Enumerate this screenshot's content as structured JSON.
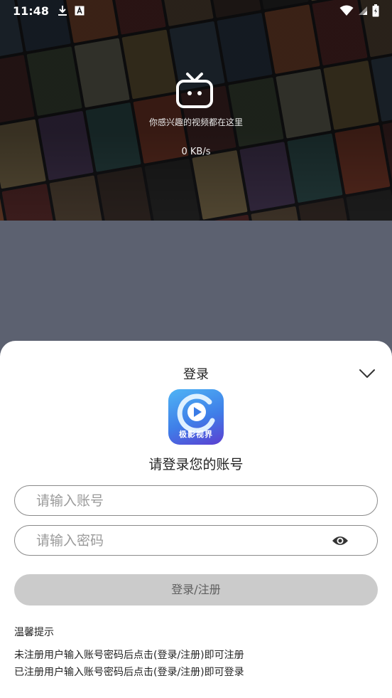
{
  "status_bar": {
    "time": "11:48",
    "icons": [
      "download-icon",
      "text-a-icon",
      "wifi-icon",
      "signal-icon",
      "battery-icon"
    ]
  },
  "hero": {
    "logo_icon": "tv-icon",
    "tagline": "你感兴趣的视频都在这里",
    "speed": "0 KB/s"
  },
  "login_sheet": {
    "title": "登录",
    "collapse_icon": "chevron-down-icon",
    "app_icon": {
      "name": "极影视界",
      "icon": "play-icon"
    },
    "subtitle": "请登录您的账号",
    "account_field": {
      "value": "",
      "placeholder": "请输入账号"
    },
    "password_field": {
      "value": "",
      "placeholder": "请输入密码",
      "toggle_icon": "eye-icon"
    },
    "submit_label": "登录/注册",
    "tips": {
      "title": "温馨提示",
      "lines": [
        "未注册用户输入账号密码后点击(登录/注册)即可注册",
        "已注册用户输入账号密码后点击(登录/注册)即可登录"
      ]
    }
  },
  "colors": {
    "sheet_background": "#ffffff",
    "dim_background": "#5c6170",
    "button_disabled": "#cbcbcb",
    "button_text": "#5e5e5e",
    "app_icon_gradient": [
      "#4fb4f5",
      "#3f7ee8",
      "#5b3fd1"
    ]
  }
}
